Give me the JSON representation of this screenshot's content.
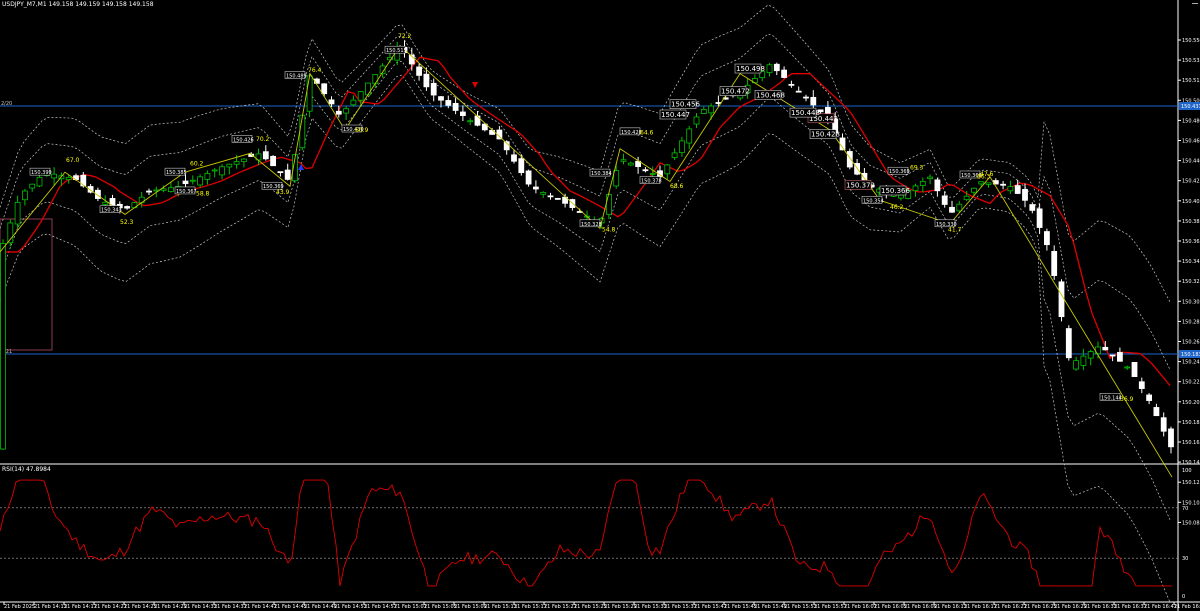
{
  "window": {
    "title": "USDJPY_M7,M1  149.158 149.159 149.158 149.158",
    "symbol": "USDJPY_M7",
    "timeframe": "M1"
  },
  "rsi_panel": {
    "title": "RSI(14) 47.8984",
    "levels": [
      "70",
      "30"
    ],
    "axis_labels": [
      "100",
      "70",
      "30",
      "0"
    ]
  },
  "colors": {
    "background": "#000000",
    "bull_candle": "#00c000",
    "bear_candle": "#ffffff",
    "moving_average": "#e00000",
    "bollinger": "#c8c8c8",
    "zigzag": "#c8c800",
    "hline": "#1e64c8",
    "rsi_line": "#e00000",
    "label_text": "#ffff00",
    "tag_text": "#ffffff"
  },
  "price_axis": {
    "labels": [
      "150.550",
      "150.535",
      "150.515",
      "150.500",
      "150.480",
      "150.460",
      "150.440",
      "150.425",
      "150.405",
      "150.385",
      "150.365",
      "150.345",
      "150.325",
      "150.305",
      "150.285",
      "150.265",
      "150.245",
      "150.225",
      "150.205",
      "150.185",
      "150.165",
      "150.145",
      "150.125",
      "150.105",
      "150.085"
    ],
    "highlight_tags": [
      {
        "text": "150.431",
        "color": "#1e64c8"
      },
      {
        "text": "150.183",
        "color": "#1e64c8"
      }
    ]
  },
  "time_axis": {
    "labels": [
      "21 Feb 2025",
      "21 Feb 14:13",
      "21 Feb 14:17",
      "21 Feb 14:21",
      "21 Feb 14:25",
      "21 Feb 14:29",
      "21 Feb 14:33",
      "21 Feb 14:37",
      "21 Feb 14:41",
      "21 Feb 14:45",
      "21 Feb 14:49",
      "21 Feb 14:53",
      "21 Feb 14:57",
      "21 Feb 15:01",
      "21 Feb 15:05",
      "21 Feb 15:09",
      "21 Feb 15:13",
      "21 Feb 15:17",
      "21 Feb 15:21",
      "21 Feb 15:25",
      "21 Feb 15:29",
      "21 Feb 15:33",
      "21 Feb 15:37",
      "21 Feb 15:41",
      "21 Feb 15:45",
      "21 Feb 15:49",
      "21 Feb 15:53",
      "21 Feb 15:57",
      "21 Feb 16:01",
      "21 Feb 16:05",
      "21 Feb 16:09",
      "21 Feb 16:13",
      "21 Feb 16:17",
      "21 Feb 16:21",
      "21 Feb 16:25",
      "21 Feb 16:29",
      "21 Feb 16:33",
      "21 Feb 16:37",
      "21 Feb 16:41",
      "21 Feb 16:45"
    ]
  },
  "hline_labels": [
    "2/20",
    "2/21"
  ],
  "price_tags": [
    "150.399",
    "150.343",
    "150.367",
    "150.385",
    "150.426",
    "150.369",
    "150.489",
    "150.430",
    "150.515",
    "150.447",
    "150.456",
    "150.472",
    "150.468",
    "150.498",
    "150.443",
    "150.448",
    "150.428",
    "150.372",
    "150.366",
    "150.369",
    "150.354",
    "150.330",
    "150.369",
    "150.378",
    "150.328",
    "150.384",
    "150.428",
    "150.144"
  ],
  "price_labels": [
    "67.0",
    "52.3",
    "60.2",
    "58.8",
    "70.2",
    "43.9",
    "76.4",
    "60.9",
    "72.2",
    "64.6",
    "54.8",
    "68.6",
    "69.3",
    "66.3",
    "47.6",
    "46.2",
    "41.7",
    "36.9"
  ],
  "chart_data": {
    "type": "candlestick",
    "symbol": "USDJPY_M7",
    "timeframe": "M1",
    "ylim": [
      150.075,
      150.56
    ],
    "indicators": [
      "Moving Average",
      "Bollinger Bands",
      "ZigZag",
      "RSI(14)"
    ],
    "rsi_last": 47.8984
  }
}
